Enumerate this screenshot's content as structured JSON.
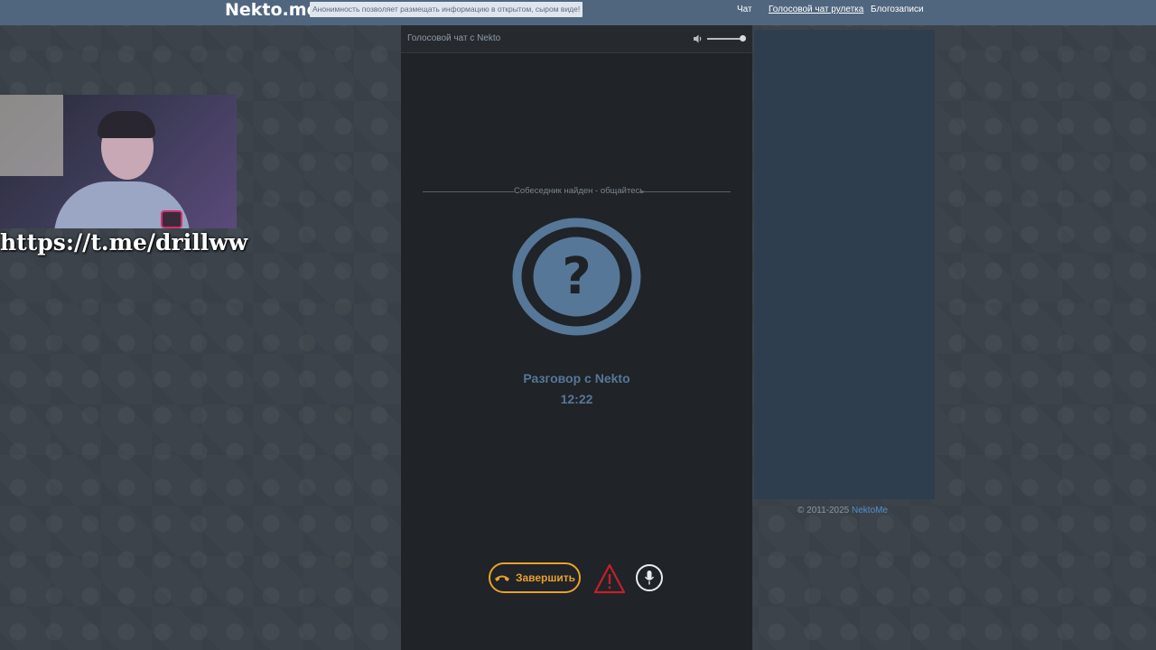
{
  "header": {
    "logo": "Nekto.me",
    "notice": "Анонимность позволяет размещать информацию в открытом, сыром виде!",
    "nav": [
      {
        "label": "Чат",
        "active": false
      },
      {
        "label": "Голосовой чат рулетка",
        "active": true
      },
      {
        "label": "Блогозаписи",
        "active": false
      }
    ]
  },
  "overlay": {
    "telegram_link": "https://t.me/drillww"
  },
  "voice_panel": {
    "title": "Голосовой чат с Nekto",
    "volume_icon": "speaker-icon",
    "volume_level": 1.0,
    "status": "Собеседник найден - общайтесь",
    "avatar_symbol": "?",
    "conversation_label": "Разговор с Nekto",
    "timer": "12:22",
    "end_button_label": "Завершить",
    "end_icon": "phone-hangup-icon",
    "report_icon": "warning-triangle-icon",
    "mic_icon": "microphone-icon"
  },
  "footer": {
    "copyright": "© 2011-2025",
    "link": "NektoMe"
  },
  "colors": {
    "topbar": "#50667f",
    "panel": "#202327",
    "accent_orange": "#e8a12c",
    "accent_blue": "#567798",
    "warning_red": "#c3202a",
    "right_panel": "#2f3e4e"
  }
}
